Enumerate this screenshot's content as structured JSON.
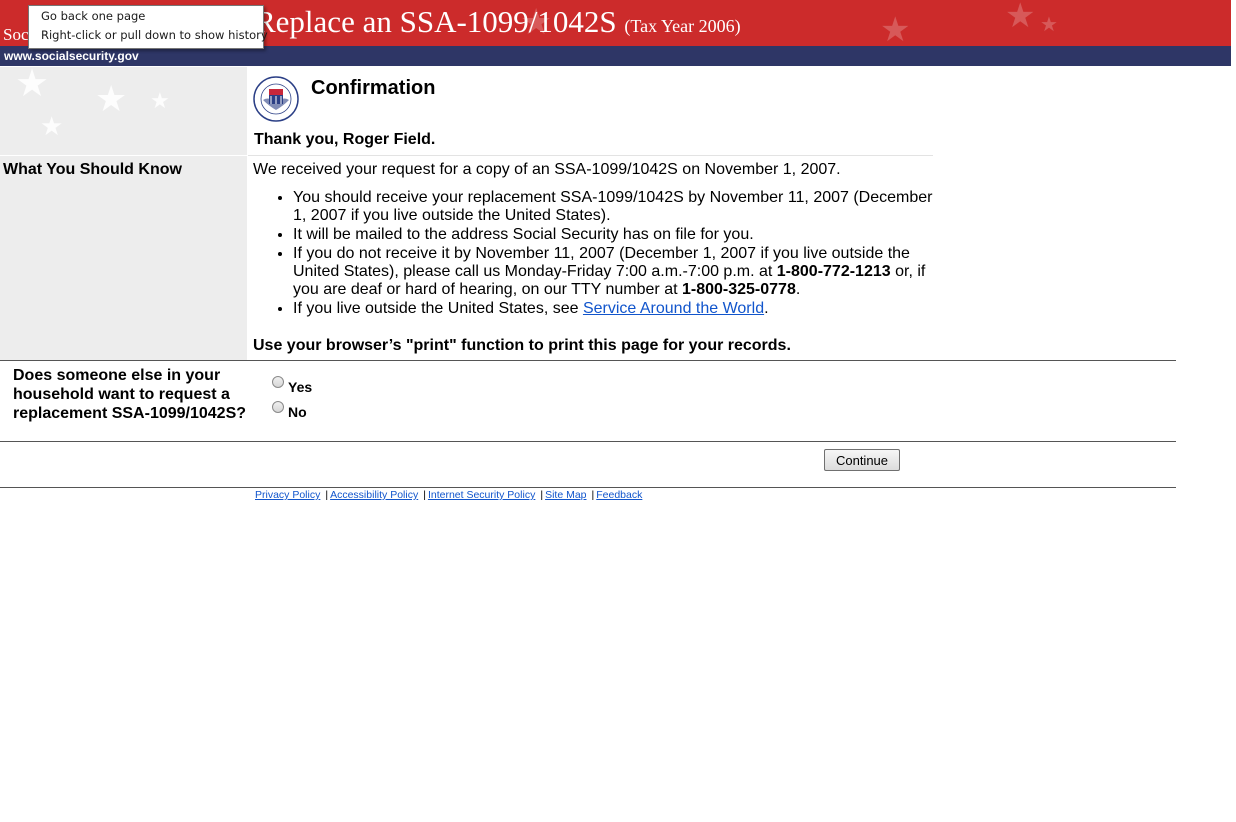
{
  "header": {
    "title": "Replace an SSA-1099/1042S",
    "tax_year": "(Tax Year 2006)",
    "agency_partial": "Soc",
    "url": "www.socialsecurity.gov"
  },
  "tooltip": {
    "line1": "Go back one page",
    "line2": "Right-click or pull down to show history"
  },
  "sidebar": {
    "section_label": "What You Should Know"
  },
  "main": {
    "heading": "Confirmation",
    "thanks": "Thank you, Roger Field.",
    "received": "We received your request for a copy of an SSA-1099/1042S on November 1, 2007.",
    "bullets": {
      "b1": "You should receive your replacement SSA-1099/1042S by November 11, 2007 (December 1, 2007 if you live outside the United States).",
      "b2": "It will be mailed to the address Social Security has on file for you.",
      "b3_part1": "If you do not receive it by November 11, 2007 (December 1, 2007 if you live outside the United States), please call us Monday-Friday 7:00 a.m.-7:00 p.m. at ",
      "b3_phone": "1-800-772-1213",
      "b3_part2": " or, if you are deaf or hard of hearing, on our TTY number at ",
      "b3_tty": "1-800-325-0778",
      "b3_part3": ".",
      "b4_part1": "If you live outside the United States, see ",
      "b4_link": "Service Around the World",
      "b4_part2": "."
    },
    "print_note": "Use your browser’s \"print\" function to print this page for your records."
  },
  "question": {
    "text": "Does someone else in your household want to request a replacement SSA-1099/1042S?",
    "options": [
      "Yes",
      "No"
    ]
  },
  "actions": {
    "continue_label": "Continue"
  },
  "footer": {
    "links": [
      "Privacy Policy",
      "Accessibility Policy",
      "Internet Security Policy",
      "Site Map",
      "Feedback"
    ],
    "separator": "|"
  },
  "colors": {
    "header_red": "#cc2b2b",
    "url_bar_navy": "#2e3666",
    "sidebar_gray": "#ededed",
    "link_blue": "#1155cc"
  }
}
